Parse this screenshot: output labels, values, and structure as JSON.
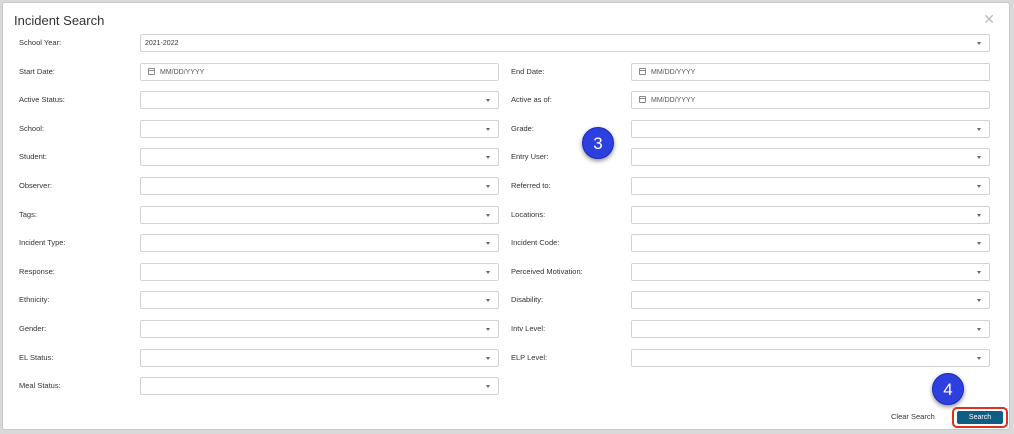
{
  "modal": {
    "title": "Incident Search"
  },
  "icons": {
    "close": "close-icon",
    "caret": "chevron-down-icon",
    "calendar": "calendar-icon"
  },
  "school_year": {
    "label": "School Year:",
    "value": "2021-2022"
  },
  "date_placeholder": "MM/DD/YYYY",
  "left_fields": [
    {
      "label": "Start Date:",
      "type": "date"
    },
    {
      "label": "Active Status:",
      "type": "select"
    },
    {
      "label": "School:",
      "type": "select"
    },
    {
      "label": "Student:",
      "type": "select"
    },
    {
      "label": "Observer:",
      "type": "select"
    },
    {
      "label": "Tags:",
      "type": "select"
    },
    {
      "label": "Incident Type:",
      "type": "select"
    },
    {
      "label": "Response:",
      "type": "select"
    },
    {
      "label": "Ethnicity:",
      "type": "select"
    },
    {
      "label": "Gender:",
      "type": "select"
    },
    {
      "label": "EL Status:",
      "type": "select"
    },
    {
      "label": "Meal Status:",
      "type": "select"
    }
  ],
  "right_fields": [
    {
      "label": "End Date:",
      "type": "date"
    },
    {
      "label": "Active as of:",
      "type": "date"
    },
    {
      "label": "Grade:",
      "type": "select"
    },
    {
      "label": "Entry User:",
      "type": "select"
    },
    {
      "label": "Referred to:",
      "type": "select"
    },
    {
      "label": "Locations:",
      "type": "select"
    },
    {
      "label": "Incident Code:",
      "type": "select"
    },
    {
      "label": "Perceived Motivation:",
      "type": "select"
    },
    {
      "label": "Disability:",
      "type": "select"
    },
    {
      "label": "Intv Level:",
      "type": "select"
    },
    {
      "label": "ELP Level:",
      "type": "select"
    }
  ],
  "badges": [
    "3",
    "4"
  ],
  "actions": {
    "clear_label": "Clear Search",
    "search_label": "Search"
  },
  "colors": {
    "search_button": "#0e5d83",
    "highlight": "#e0301e",
    "badge": "#2e3fe0"
  }
}
